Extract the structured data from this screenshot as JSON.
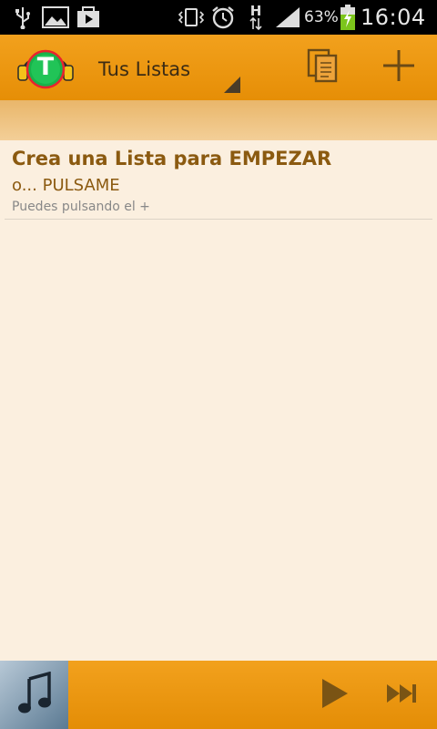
{
  "status_bar": {
    "battery_percent": "63%",
    "time": "16:04",
    "network_label": "H",
    "icons": [
      "usb-icon",
      "image-icon",
      "play-store-icon",
      "vibrate-icon",
      "alarm-icon",
      "data-arrows-icon",
      "signal-icon",
      "battery-charging-icon"
    ]
  },
  "action_bar": {
    "logo_letter": "T",
    "title": "Tus Listas",
    "actions": [
      "copy-icon",
      "add-icon"
    ]
  },
  "list": {
    "items": [
      {
        "title": "Crea una Lista para EMPEZAR",
        "subtitle": "o... PULSAME",
        "hint": "Puedes pulsando el +"
      }
    ]
  },
  "player": {
    "thumbnail_icon": "music-note-icon",
    "controls": [
      "play-icon",
      "next-icon"
    ]
  },
  "colors": {
    "accent": "#f2a11d",
    "background": "#fbefdf",
    "text_brown": "#8b5a10"
  }
}
